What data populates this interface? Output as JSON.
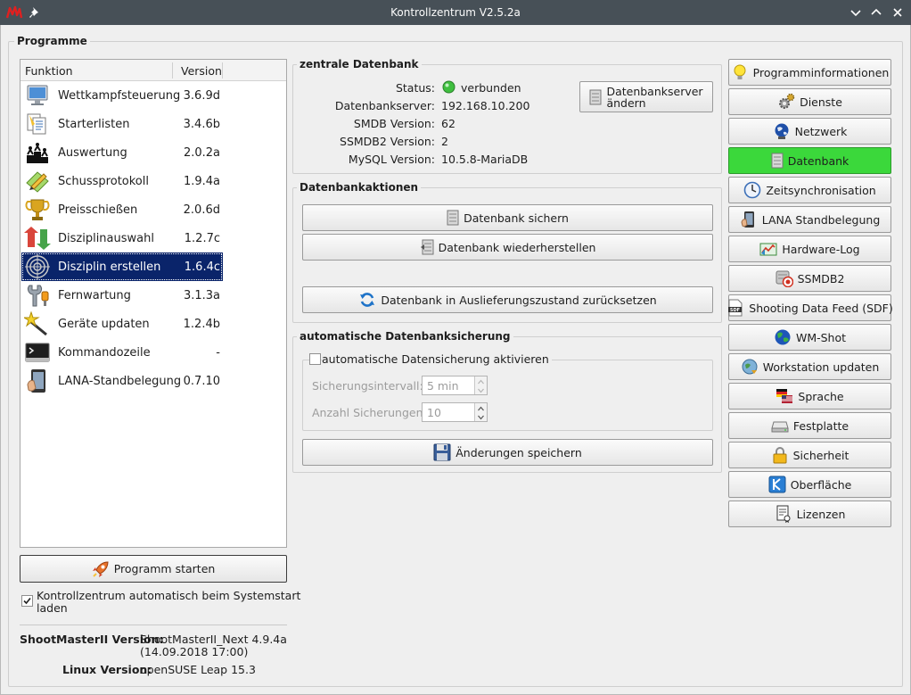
{
  "window": {
    "title": "Kontrollzentrum V2.5.2a"
  },
  "programs_group": {
    "title": "Programme"
  },
  "table": {
    "col_function": "Funktion",
    "col_version": "Version",
    "rows": [
      {
        "function": "Wettkampfsteuerung",
        "version": "3.6.9d",
        "icon": "monitor-icon"
      },
      {
        "function": "Starterlisten",
        "version": "3.4.6b",
        "icon": "lists-icon"
      },
      {
        "function": "Auswertung",
        "version": "2.0.2a",
        "icon": "podium-icon"
      },
      {
        "function": "Schussprotokoll",
        "version": "1.9.4a",
        "icon": "pencil-note-icon"
      },
      {
        "function": "Preisschießen",
        "version": "2.0.6d",
        "icon": "trophy-icon"
      },
      {
        "function": "Disziplinauswahl",
        "version": "1.2.7c",
        "icon": "arrows-icon"
      },
      {
        "function": "Disziplin erstellen",
        "version": "1.6.4c",
        "icon": "target-icon"
      },
      {
        "function": "Fernwartung",
        "version": "3.1.3a",
        "icon": "wrench-icon"
      },
      {
        "function": "Geräte updaten",
        "version": "1.2.4b",
        "icon": "magic-wand-icon"
      },
      {
        "function": "Kommandozeile",
        "version": "-",
        "icon": "terminal-icon"
      },
      {
        "function": "LANA-Standbelegung",
        "version": "0.7.10",
        "icon": "tablet-icon"
      }
    ]
  },
  "start_button": {
    "label": "Programm starten"
  },
  "autostart": {
    "label_line1": "Kontrollzentrum automatisch beim Systemstart",
    "label_line2": "laden",
    "checked": true
  },
  "versions": {
    "sm_label": "ShootMasterII Version:",
    "sm_value_line1": "ShootMasterII_Next 4.9.4a",
    "sm_value_line2": "(14.09.2018 17:00)",
    "linux_label": "Linux Version:",
    "linux_value": "openSUSE Leap 15.3"
  },
  "central_db": {
    "title": "zentrale Datenbank",
    "status_label": "Status:",
    "status_value": "verbunden",
    "status_color": "#3fbf3f",
    "server_label": "Datenbankserver:",
    "server_value": "192.168.10.200",
    "smdb_label": "SMDB Version:",
    "smdb_value": "62",
    "ssmdb2_label": "SSMDB2 Version:",
    "ssmdb2_value": "2",
    "mysql_label": "MySQL Version:",
    "mysql_value": "10.5.8-MariaDB",
    "change_btn_line1": "Datenbankserver",
    "change_btn_line2": "ändern"
  },
  "db_actions": {
    "title": "Datenbankaktionen",
    "backup": "Datenbank sichern",
    "restore": "Datenbank wiederherstellen",
    "reset": "Datenbank in Auslieferungszustand zurücksetzen"
  },
  "auto_backup": {
    "title": "automatische Datenbanksicherung",
    "enable_label": "automatische Datensicherung aktivieren",
    "enabled": false,
    "interval_label": "Sicherungsintervall:",
    "interval_value": "5 min",
    "count_label": "Anzahl Sicherungen:",
    "count_value": "10",
    "save_label": "Änderungen speichern"
  },
  "nav": [
    {
      "label": "Programminformationen",
      "icon": "lightbulb-icon",
      "active": false
    },
    {
      "label": "Dienste",
      "icon": "gears-icon",
      "active": false
    },
    {
      "label": "Netzwerk",
      "icon": "globe-network-icon",
      "active": false
    },
    {
      "label": "Datenbank",
      "icon": "database-icon",
      "active": true
    },
    {
      "label": "Zeitsynchronisation",
      "icon": "clock-icon",
      "active": false
    },
    {
      "label": "LANA Standbelegung",
      "icon": "tablet-icon",
      "active": false
    },
    {
      "label": "Hardware-Log",
      "icon": "chart-log-icon",
      "active": false
    },
    {
      "label": "SSMDB2",
      "icon": "db-target-icon",
      "active": false
    },
    {
      "label": "Shooting Data Feed (SDF)",
      "icon": "sdf-file-icon",
      "active": false
    },
    {
      "label": "WM-Shot",
      "icon": "earth-icon",
      "active": false
    },
    {
      "label": "Workstation updaten",
      "icon": "update-globe-icon",
      "active": false
    },
    {
      "label": "Sprache",
      "icon": "flags-icon",
      "active": false
    },
    {
      "label": "Festplatte",
      "icon": "harddisk-icon",
      "active": false
    },
    {
      "label": "Sicherheit",
      "icon": "padlock-icon",
      "active": false
    },
    {
      "label": "Oberfläche",
      "icon": "kde-icon",
      "active": false
    },
    {
      "label": "Lizenzen",
      "icon": "certificate-icon",
      "active": false
    }
  ],
  "colors": {
    "selection": "#0a246a",
    "active_nav": "#3bd83b",
    "titlebar": "#475057"
  }
}
